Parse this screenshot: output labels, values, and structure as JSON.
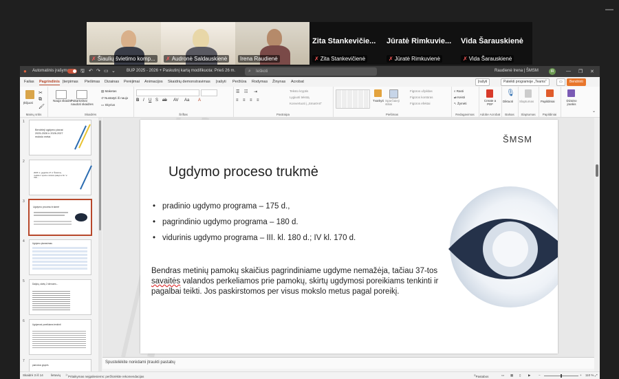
{
  "teams": {
    "participants": [
      {
        "label": "Šiaulių švietimo komp...",
        "big_name": "",
        "muted": true
      },
      {
        "label": "Audronė Saldauskienė",
        "big_name": "",
        "muted": true
      },
      {
        "label": "Irena Raudienė",
        "big_name": "",
        "muted": false
      },
      {
        "label": "Zita Stankevičienė",
        "big_name": "Zita Stankevičie...",
        "muted": true
      },
      {
        "label": "Jūratė Rimkuvienė",
        "big_name": "Jūratė Rimkuvie...",
        "muted": true
      },
      {
        "label": "Vida Šarauskienė",
        "big_name": "Vida Šarauskienė",
        "muted": true
      }
    ],
    "minimize_icon": "minimize-icon"
  },
  "ppt": {
    "autosave_label": "Automatinis įrašymas",
    "doc_title": "BUP 2025 - 2026 + Paskutinį kartą modifikuota: Prieš 26 m.",
    "search_placeholder": "Ieškoti",
    "user_name": "Raudienė Irena | ŠMSM",
    "avatar_initials": "IR",
    "tabs": [
      "Failas",
      "Pagrindinis",
      "Įterpimas",
      "Piešimas",
      "Dizainas",
      "Perėjimai",
      "Animacijos",
      "Skaidrių demonstravimas",
      "Įrašyti",
      "Peržiūra",
      "Rodymas",
      "Žinynas",
      "Acrobat"
    ],
    "active_tab": "Pagrindinis",
    "top_buttons": {
      "record": "Įrašyti",
      "present": "Pateikti programoje „Teams“",
      "share": "Bendrinti"
    },
    "ribbon_groups": {
      "clipboard": {
        "name": "Mainų sritis",
        "paste": "Įklijuoti"
      },
      "slides": {
        "name": "Skaidrės",
        "new_slide": "Nauja skaidrė",
        "reuse": "Pakartotinai naudoti skaidres",
        "layout": "Maketas",
        "reset": "Nustatyti iš naujo",
        "section": "Skyrius"
      },
      "font": {
        "name": "Šriftas"
      },
      "paragraph": {
        "name": "Pastraipa",
        "text_dir": "Teksto kryptis",
        "align_text": "Lygiuoti tekstą",
        "smartart": "Konvertuoti į „SmartArt“"
      },
      "drawing": {
        "name": "Piešimas",
        "arrange": "Tvarkyti",
        "quick_styles": "Sparčiaieji stiliai",
        "fill": "Figūros užpildas",
        "outline": "Figūros kontūras",
        "effects": "Figūros efektai"
      },
      "editing": {
        "name": "Redagavimas",
        "find": "Rasti",
        "replace": "Keisti",
        "select": "Žymėti"
      },
      "acrobat": {
        "name": "Adobe Acrobat",
        "create_pdf": "Create a PDF"
      },
      "voice": {
        "name": "Balsas",
        "dictate": "Diktuoti"
      },
      "sensitivity": {
        "name": "Slaptumas",
        "label": "Slaptumas"
      },
      "addins": {
        "name": "Papildiniai",
        "label": "Papildiniai"
      },
      "designer": {
        "name": "",
        "label": "Dizaino įrankis"
      }
    },
    "slide": {
      "logo": "ŠMSM",
      "title": "Ugdymo proceso trukmė",
      "bullets": [
        "pradinio ugdymo programa – 175 d.,",
        "pagrindinio ugdymo programa – 180 d.",
        "vidurinis ugdymo programa – III. kl. 180 d.; IV kl. 170 d."
      ],
      "para_part1": "Bendras metinių pamokų skaičius pagrindiniame ugdyme nemažėja, tačiau 37-tos ",
      "para_underlined": "savaitės",
      "para_part2": " valandos perkeliamos prie pamokų, skirtų ugdymosi poreikiams tenkinti ir pagalbai teikti. Jos paskirstomos per visus mokslo metus pagal poreikį."
    },
    "thumbnails": [
      {
        "num": "1",
        "text": "Bendrieji ugdymo planai 2025-2026 ir 2026-2027 mokslo metai"
      },
      {
        "num": "2",
        "text": "2025 m. gegužės 27 d. Švietimo, mokslo ir sporto ministro įsakymu Nr. V-708 ..."
      },
      {
        "num": "3",
        "text": "Ugdymo proceso trukmė"
      },
      {
        "num": "4",
        "text": "Ugdymo planavimas"
      },
      {
        "num": "5",
        "text": "Dalykų, skirtų 2 dienoms..."
      },
      {
        "num": "6",
        "text": "Ugdymosi poreikiams tenkinti"
      },
      {
        "num": "7",
        "text": "pamokos grupės"
      }
    ],
    "notes_placeholder": "Spustelėkite norėdami įtraukti pastabų",
    "status": {
      "slide_counter": "Skaidrė 3 iš 14",
      "language": "lietuvių",
      "accessibility": "Pritaikymas neįgaliesiems: peržiūrėkite rekomendacijas",
      "notes": "Pastabos",
      "zoom": "110 %"
    }
  },
  "colors": {
    "accent": "#b7472a",
    "share": "#e8762b",
    "active_tile": "#6ad16a"
  }
}
